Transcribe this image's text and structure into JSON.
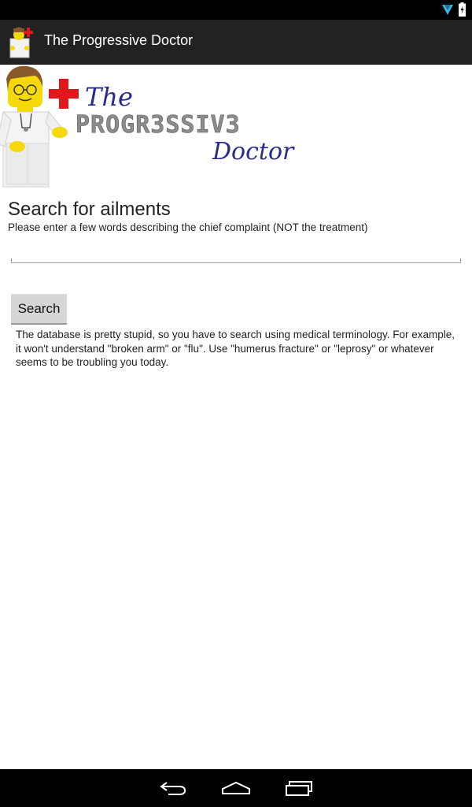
{
  "status_bar": {
    "icons": [
      "wifi-icon",
      "battery-charging-icon"
    ]
  },
  "action_bar": {
    "title": "The Progressive Doctor",
    "icon": "lego-doctor-icon"
  },
  "logo": {
    "line1": "The",
    "line2": "PROGR3SSIV3",
    "line3": "Doctor"
  },
  "main": {
    "heading": "Search for ailments",
    "subheading": "Please enter a few words describing the chief complaint (NOT the treatment)",
    "search_input": {
      "value": "",
      "placeholder": ""
    },
    "search_button_label": "Search",
    "note": "The database is pretty stupid, so you have to search using medical terminology. For example, it won't understand \"broken arm\" or \"flu\". Use \"humerus fracture\" or \"leprosy\" or whatever seems to be troubling you today."
  },
  "nav_bar": {
    "icons": [
      "back-icon",
      "home-icon",
      "recent-apps-icon"
    ]
  },
  "colors": {
    "action_bar_bg": "#222222",
    "logo_blue": "#2a2a8a",
    "logo_cross_red": "#e0181b"
  }
}
